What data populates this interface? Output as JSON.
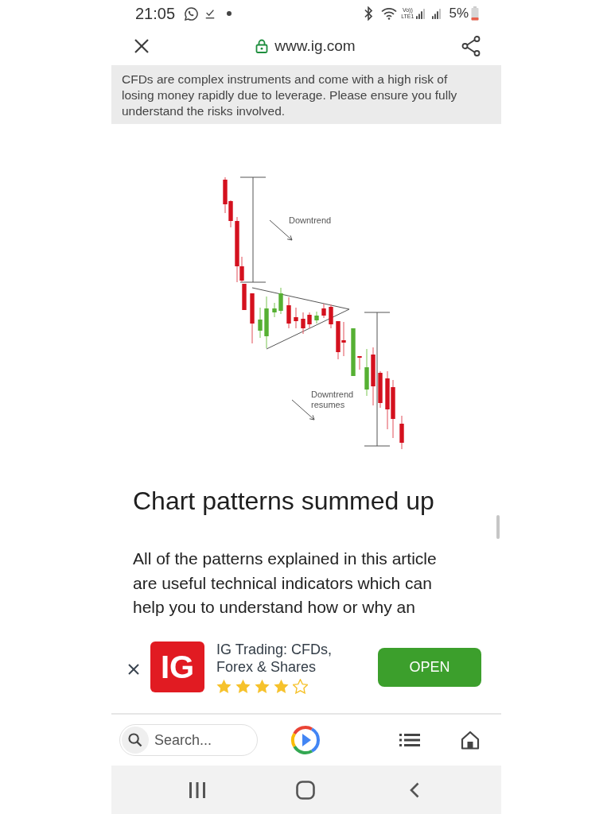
{
  "status_bar": {
    "time": "21:05",
    "volte_top": "Vo))",
    "volte_bottom": "LTE1",
    "battery": "5%"
  },
  "browser_bar": {
    "secure": true,
    "url": "www.ig.com"
  },
  "risk_warning": "CFDs are complex instruments and come with a high risk of losing money rapidly due to leverage. Please ensure you fully understand the risks involved.",
  "chart_image": {
    "labels": [
      "Downtrend",
      "Downtrend resumes"
    ]
  },
  "article": {
    "heading": "Chart patterns summed up",
    "paragraph": "All of the patterns explained in this article are useful technical indicators which can help you to understand how or why an"
  },
  "app_banner": {
    "logo": "IG",
    "title": "IG Trading: CFDs, Forex & Shares",
    "stars": 4,
    "button": "OPEN"
  },
  "toolbar": {
    "search": {
      "placeholder": "Search..."
    }
  }
}
